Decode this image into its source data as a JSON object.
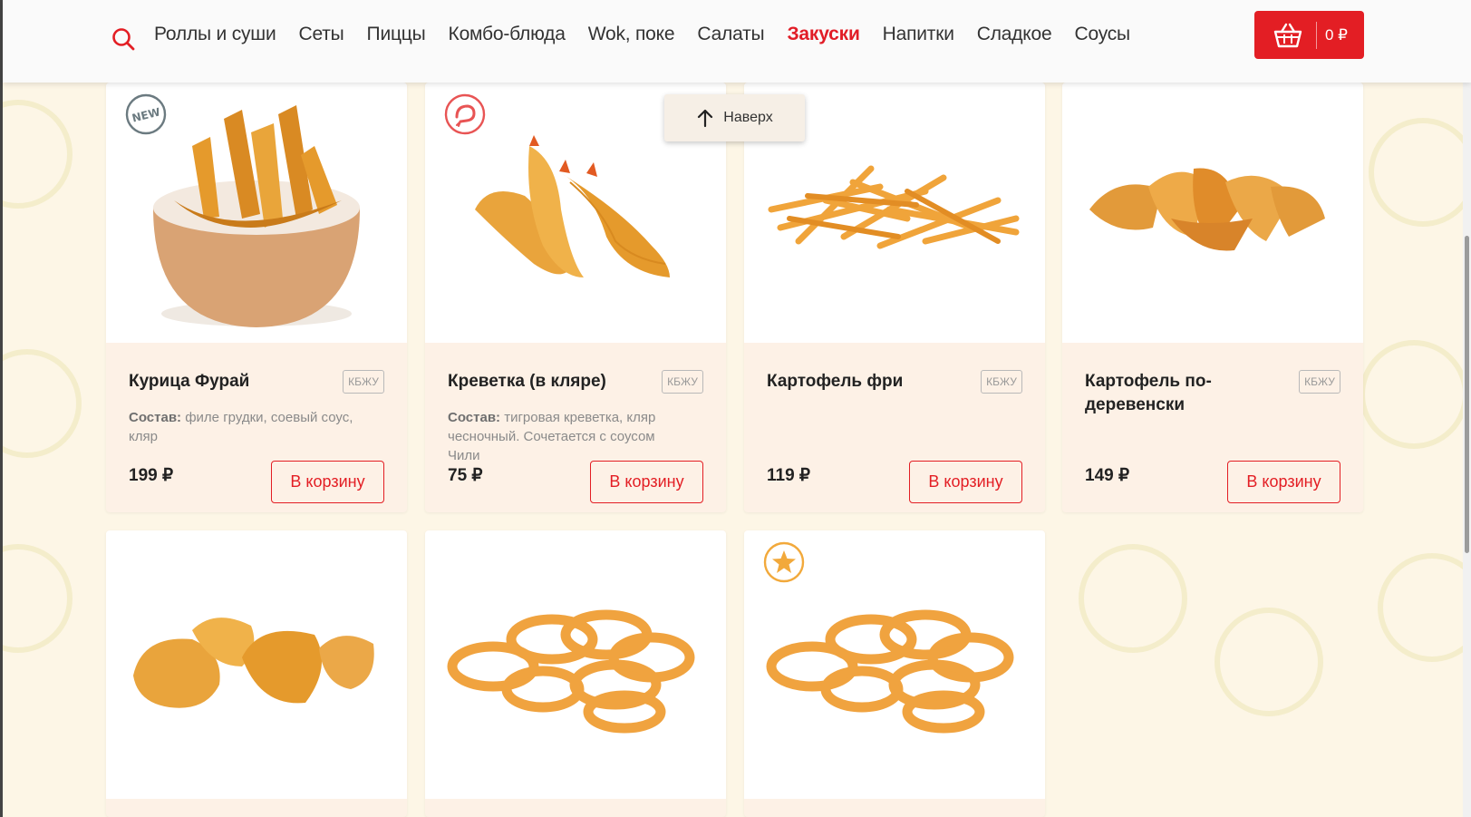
{
  "nav": {
    "items": [
      "Роллы и суши",
      "Сеты",
      "Пиццы",
      "Комбо-блюда",
      "Wok, поке",
      "Салаты",
      "Закуски",
      "Напитки",
      "Сладкое",
      "Соусы"
    ],
    "active_index": 6
  },
  "cart": {
    "total": "0 ₽"
  },
  "scroll_top_label": "Наверх",
  "colors": {
    "accent": "#e31e24",
    "card_bg": "#fdf1e6",
    "page_bg": "#fdf6e6"
  },
  "products": [
    {
      "title": "Курица Фурай",
      "kbju": "КБЖУ",
      "composition_label": "Состав:",
      "composition": " филе грудки, соевый соус, кляр",
      "price": "199 ₽",
      "button": "В корзину",
      "badge": "new-icon"
    },
    {
      "title": "Креветка (в кляре)",
      "kbju": "КБЖУ",
      "composition_label": "Состав:",
      "composition": " тигровая креветка, кляр чесночный. Сочетается с соусом Чили",
      "price": "75 ₽",
      "button": "В корзину",
      "badge": "shrimp-icon"
    },
    {
      "title": "Картофель фри",
      "kbju": "КБЖУ",
      "price": "119 ₽",
      "button": "В корзину"
    },
    {
      "title": "Картофель по-деревенски",
      "kbju": "КБЖУ",
      "price": "149 ₽",
      "button": "В корзину"
    },
    {
      "image": "nuggets"
    },
    {
      "image": "onion-rings"
    },
    {
      "image": "onion-rings",
      "badge": "star-icon"
    }
  ]
}
